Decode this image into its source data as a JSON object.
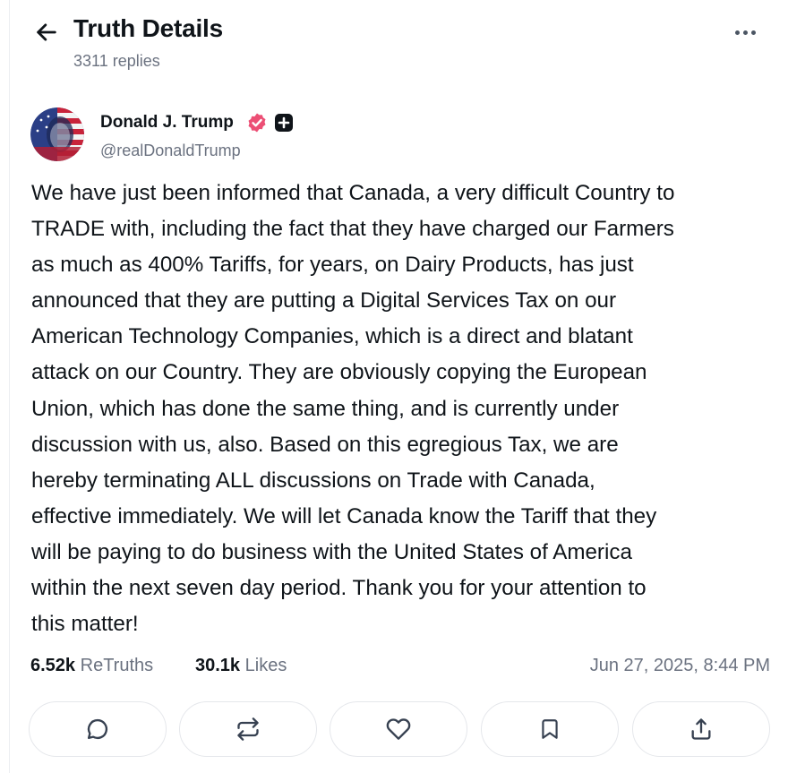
{
  "header": {
    "title": "Truth Details",
    "replies": "3311 replies",
    "back_icon": "arrow-left-icon",
    "more_icon": "more-horizontal-icon"
  },
  "author": {
    "name": "Donald J. Trump",
    "handle": "@realDonaldTrump",
    "verified_icon": "verified-badge-icon",
    "plus_icon": "plus-square-icon",
    "verified_color": "#ec4f75"
  },
  "post": {
    "text": "We have just been informed that Canada, a very difficult Country to\nTRADE with, including the fact that they have charged our Farmers\nas much as 400% Tariffs, for years, on Dairy Products, has just\nannounced that they are putting a Digital Services Tax on our\nAmerican Technology Companies, which is a direct and blatant\nattack on our Country. They are obviously copying the European\nUnion, which has done the same thing, and is currently under\ndiscussion with us, also. Based on this egregious Tax, we are\nhereby terminating ALL discussions on Trade with Canada,\neffective immediately. We will let Canada know the Tariff that they\nwill be paying to do business with the United States of America\nwithin the next seven day period. Thank you for your attention to\nthis matter!"
  },
  "stats": {
    "retruths_count": "6.52k",
    "retruths_label": "ReTruths",
    "likes_count": "30.1k",
    "likes_label": "Likes",
    "timestamp": "Jun 27, 2025, 8:44 PM"
  },
  "actions": [
    {
      "icon": "reply-icon"
    },
    {
      "icon": "retruth-icon"
    },
    {
      "icon": "heart-icon"
    },
    {
      "icon": "bookmark-icon"
    },
    {
      "icon": "share-icon"
    }
  ]
}
